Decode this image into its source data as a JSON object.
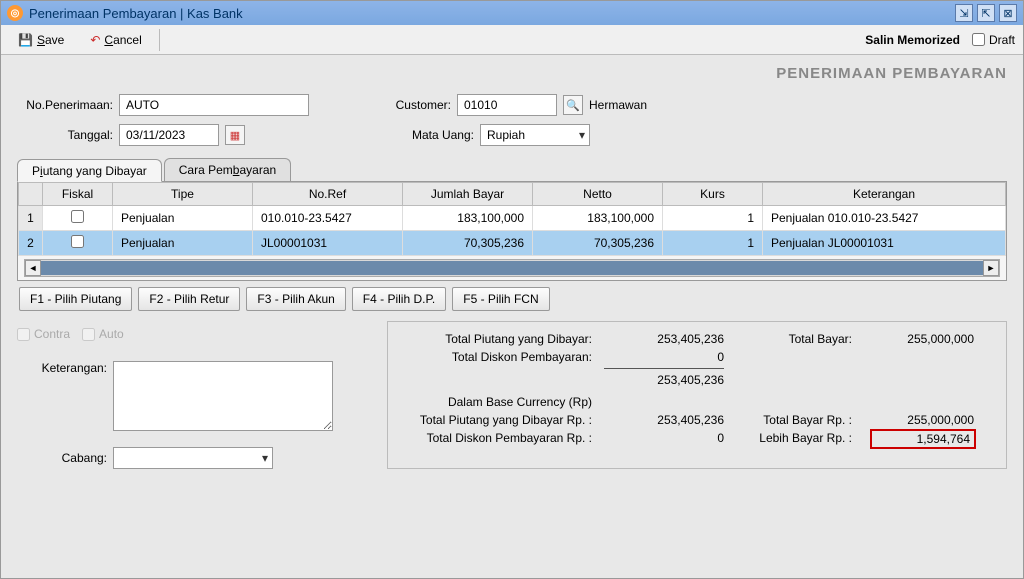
{
  "window": {
    "title": "Penerimaan Pembayaran | Kas Bank"
  },
  "toolbar": {
    "save": "Save",
    "cancel": "Cancel",
    "salin_memorized": "Salin Memorized",
    "draft": "Draft"
  },
  "page_header": "PENERIMAAN PEMBAYARAN",
  "form": {
    "no_penerimaan_label": "No.Penerimaan:",
    "no_penerimaan_value": "AUTO",
    "tanggal_label": "Tanggal:",
    "tanggal_value": "03/11/2023",
    "customer_label": "Customer:",
    "customer_code": "01010",
    "customer_name": "Hermawan",
    "mata_uang_label": "Mata Uang:",
    "mata_uang_value": "Rupiah"
  },
  "tabs": {
    "tab1": "Piutang yang Dibayar",
    "tab2": "Cara Pembayaran"
  },
  "grid": {
    "headers": {
      "fiskal": "Fiskal",
      "tipe": "Tipe",
      "noref": "No.Ref",
      "jumlah": "Jumlah Bayar",
      "netto": "Netto",
      "kurs": "Kurs",
      "keterangan": "Keterangan"
    },
    "rows": [
      {
        "n": "1",
        "tipe": "Penjualan",
        "noref": "010.010-23.5427",
        "jumlah": "183,100,000",
        "netto": "183,100,000",
        "kurs": "1",
        "ket": "Penjualan 010.010-23.5427"
      },
      {
        "n": "2",
        "tipe": "Penjualan",
        "noref": "JL00001031",
        "jumlah": "70,305,236",
        "netto": "70,305,236",
        "kurs": "1",
        "ket": "Penjualan JL00001031"
      }
    ]
  },
  "actions": {
    "f1": "F1 - Pilih Piutang",
    "f2": "F2 - Pilih Retur",
    "f3": "F3 - Pilih Akun",
    "f4": "F4 - Pilih D.P.",
    "f5": "F5 - Pilih FCN"
  },
  "lower": {
    "contra": "Contra",
    "auto": "Auto",
    "keterangan_label": "Keterangan:",
    "cabang_label": "Cabang:"
  },
  "summary": {
    "total_piutang_label": "Total Piutang yang Dibayar:",
    "total_piutang_val": "253,405,236",
    "total_diskon_label": "Total Diskon Pembayaran:",
    "total_diskon_val": "0",
    "subtotal_val": "253,405,236",
    "total_bayar_label": "Total Bayar:",
    "total_bayar_val": "255,000,000",
    "base_currency_label": "Dalam Base Currency (Rp)",
    "total_piutang_rp_label": "Total Piutang yang Dibayar Rp. :",
    "total_piutang_rp_val": "253,405,236",
    "total_diskon_rp_label": "Total Diskon Pembayaran Rp. :",
    "total_diskon_rp_val": "0",
    "total_bayar_rp_label": "Total Bayar Rp. :",
    "total_bayar_rp_val": "255,000,000",
    "lebih_bayar_rp_label": "Lebih Bayar Rp. :",
    "lebih_bayar_rp_val": "1,594,764"
  }
}
